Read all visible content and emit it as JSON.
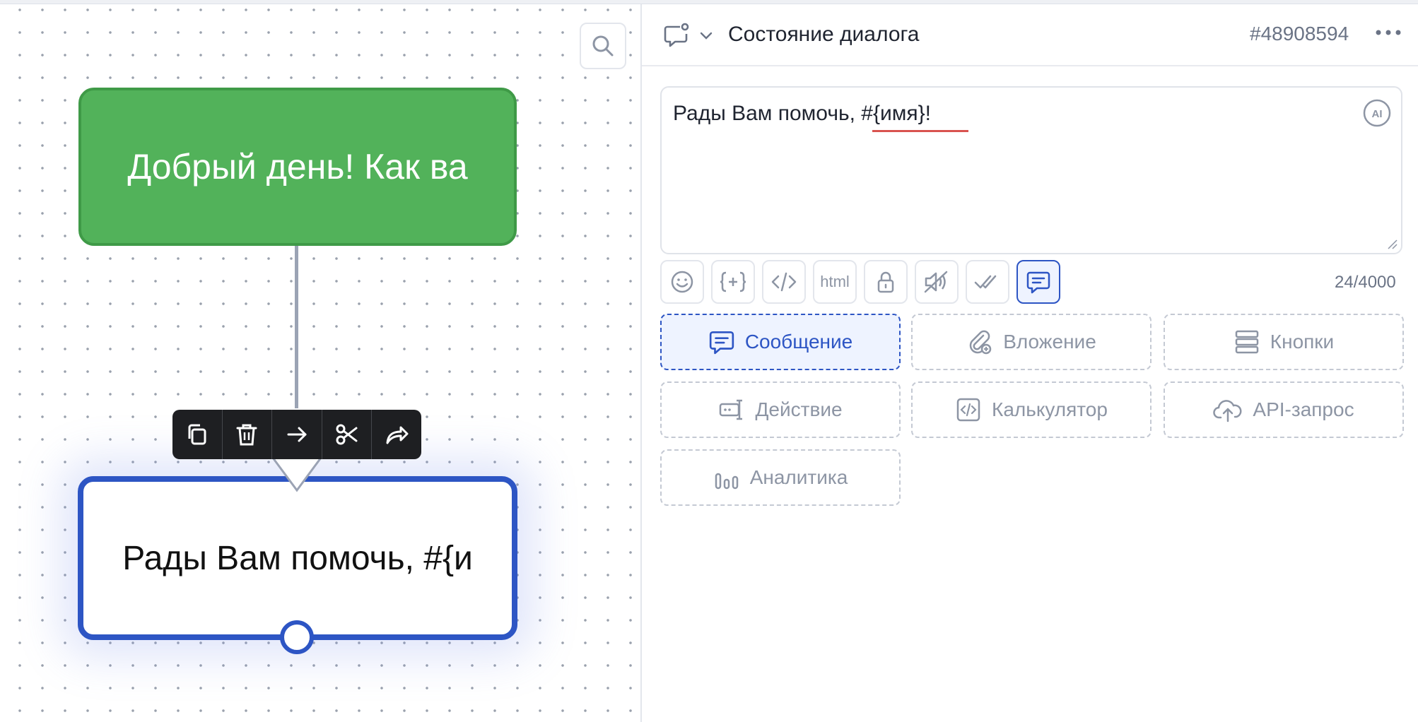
{
  "canvas": {
    "nodes": {
      "green_text": "Добрый день!  Как ва",
      "white_text": "Рады Вам помочь, #{и"
    },
    "toolbar": {
      "icons": [
        "copy-icon",
        "trash-icon",
        "arrow-right-icon",
        "scissors-icon",
        "share-icon"
      ]
    },
    "colors": {
      "green": "#52b25a",
      "accent": "#2d55c4",
      "toolbar": "#1e1f22"
    }
  },
  "panel": {
    "title": "Состояние диалога",
    "id": "#48908594",
    "editor": {
      "text": "Рады Вам помочь, #{имя}!"
    },
    "format_buttons": {
      "html_label": "html",
      "icons": [
        "emoji-icon",
        "variable-icon",
        "code-icon",
        "html-icon",
        "lock-icon",
        "sound-off-icon",
        "double-check-icon",
        "message-icon"
      ]
    },
    "counter": "24/4000",
    "blocks": {
      "message": "Сообщение",
      "attachment": "Вложение",
      "buttons": "Кнопки",
      "action": "Действие",
      "calculator": "Калькулятор",
      "api": "API-запрос",
      "analytics": "Аналитика"
    }
  }
}
